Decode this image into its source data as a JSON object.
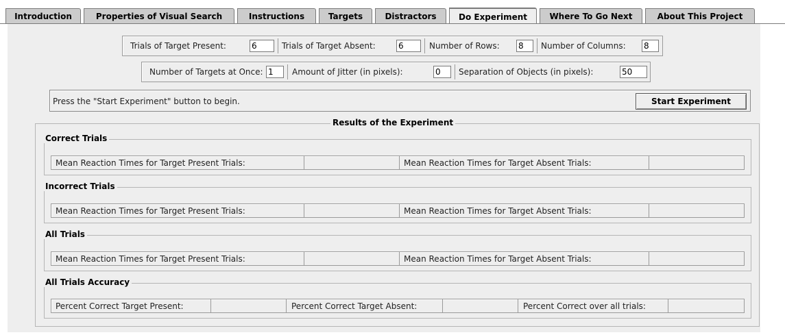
{
  "tabs": [
    {
      "label": "Introduction",
      "active": false
    },
    {
      "label": "Properties of Visual Search",
      "active": false
    },
    {
      "label": "Instructions",
      "active": false
    },
    {
      "label": "Targets",
      "active": false
    },
    {
      "label": "Distractors",
      "active": false
    },
    {
      "label": "Do Experiment",
      "active": true
    },
    {
      "label": "Where To Go Next",
      "active": false
    },
    {
      "label": "About This Project",
      "active": false
    }
  ],
  "settings": {
    "trials_present_label": "Trials of Target Present:",
    "trials_present_value": "6",
    "trials_absent_label": "Trials of Target Absent:",
    "trials_absent_value": "6",
    "rows_label": "Number of Rows:",
    "rows_value": "8",
    "columns_label": "Number of Columns:",
    "columns_value": "8",
    "targets_label": "Number of Targets at Once:",
    "targets_value": "1",
    "jitter_label": "Amount of Jitter (in pixels):",
    "jitter_value": "0",
    "separation_label": "Separation of Objects (in pixels):",
    "separation_value": "50"
  },
  "status": {
    "message": "Press the \"Start Experiment\" button to begin.",
    "start_button": "Start Experiment"
  },
  "results": {
    "title": "Results of the Experiment",
    "correct": {
      "title": "Correct Trials",
      "present_label": "Mean Reaction Times for Target Present Trials:",
      "present_value": "",
      "absent_label": "Mean Reaction Times for Target Absent Trials:",
      "absent_value": ""
    },
    "incorrect": {
      "title": "Incorrect Trials",
      "present_label": "Mean Reaction Times for Target Present Trials:",
      "present_value": "",
      "absent_label": "Mean Reaction Times for Target Absent Trials:",
      "absent_value": ""
    },
    "all": {
      "title": "All Trials",
      "present_label": "Mean Reaction Times for Target Present Trials:",
      "present_value": "",
      "absent_label": "Mean Reaction Times for Target Absent Trials:",
      "absent_value": ""
    },
    "accuracy": {
      "title": "All Trials Accuracy",
      "present_label": "Percent Correct Target Present:",
      "present_value": "",
      "absent_label": "Percent Correct Target Absent:",
      "absent_value": "",
      "overall_label": "Percent Correct over all trials:",
      "overall_value": ""
    }
  }
}
